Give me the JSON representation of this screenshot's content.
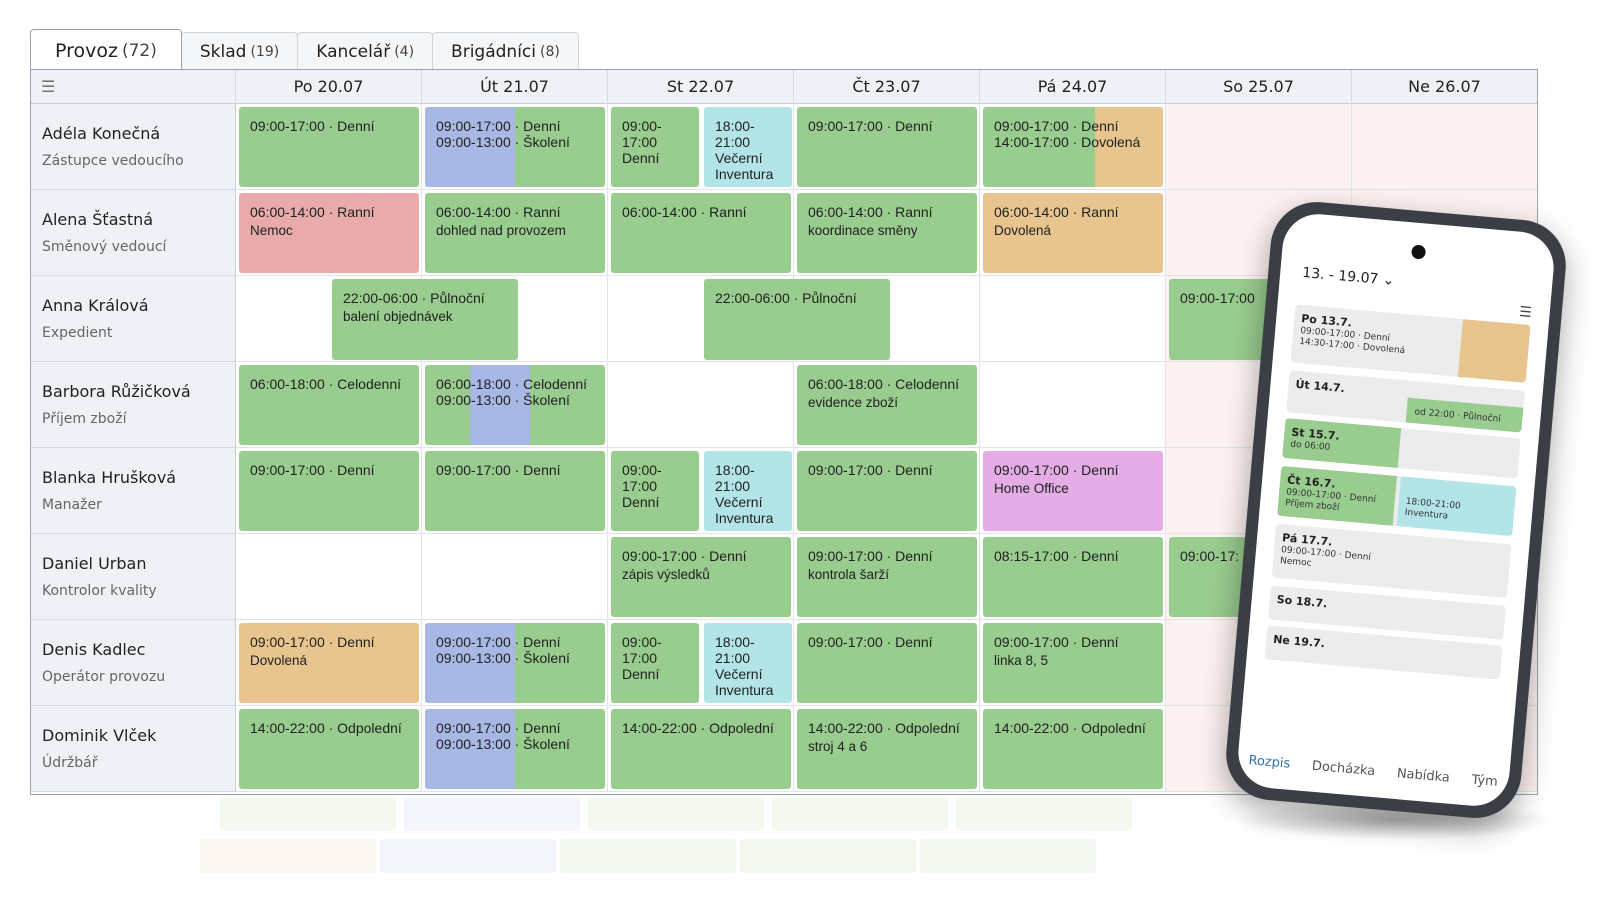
{
  "tabs": [
    {
      "label": "Provoz",
      "count": "(72)",
      "active": true
    },
    {
      "label": "Sklad",
      "count": "(19)",
      "active": false
    },
    {
      "label": "Kancelář",
      "count": "(4)",
      "active": false
    },
    {
      "label": "Brigádníci",
      "count": "(8)",
      "active": false
    }
  ],
  "days": [
    "Po 20.07",
    "Út 21.07",
    "St 22.07",
    "Čt 23.07",
    "Pá 24.07",
    "So 25.07",
    "Ne 26.07"
  ],
  "employees": [
    {
      "name": "Adéla Konečná",
      "role": "Zástupce vedoucího"
    },
    {
      "name": "Alena Šťastná",
      "role": "Směnový vedoucí"
    },
    {
      "name": "Anna Králová",
      "role": "Expedient"
    },
    {
      "name": "Barbora Růžičková",
      "role": "Příjem zboží"
    },
    {
      "name": "Blanka Hrušková",
      "role": "Manažer"
    },
    {
      "name": "Daniel Urban",
      "role": "Kontrolor kvality"
    },
    {
      "name": "Denis Kadlec",
      "role": "Operátor provozu"
    },
    {
      "name": "Dominik Vlček",
      "role": "Údržbář"
    }
  ],
  "shifts": {
    "s0_0": [
      "09:00-17:00 · Denní"
    ],
    "s0_1": [
      "09:00-17:00 · Denní",
      "09:00-13:00 · Školení"
    ],
    "s0_2a": [
      "09:00-",
      "17:00",
      "Denní"
    ],
    "s0_2b": [
      "18:00-",
      "21:00",
      "Večerní",
      "Inventura"
    ],
    "s0_3": [
      "09:00-17:00 · Denní"
    ],
    "s0_4": [
      "09:00-17:00 · Denní",
      "14:00-17:00 · Dovolená"
    ],
    "s1_0": [
      "06:00-14:00 · Ranní",
      "Nemoc"
    ],
    "s1_1": [
      "06:00-14:00 · Ranní",
      "dohled nad provozem"
    ],
    "s1_2": [
      "06:00-14:00 · Ranní"
    ],
    "s1_3": [
      "06:00-14:00 · Ranní",
      "koordinace směny"
    ],
    "s1_4": [
      "06:00-14:00 · Ranní",
      "Dovolená"
    ],
    "s2_a": [
      "22:00-06:00 · Půlnoční",
      "balení objednávek"
    ],
    "s2_b": [
      "22:00-06:00 · Půlnoční"
    ],
    "s2_c": [
      "09:00-17:00"
    ],
    "s3_0": [
      "06:00-18:00 · Celodenní"
    ],
    "s3_1": [
      "06:00-18:00 · Celodenní",
      "09:00-13:00 · Školení"
    ],
    "s3_3": [
      "06:00-18:00 · Celodenní",
      "evidence zboží"
    ],
    "s4_0": [
      "09:00-17:00 · Denní"
    ],
    "s4_1": [
      "09:00-17:00 · Denní"
    ],
    "s4_2a": [
      "09:00-",
      "17:00",
      "Denní"
    ],
    "s4_2b": [
      "18:00-",
      "21:00",
      "Večerní",
      "Inventura"
    ],
    "s4_3": [
      "09:00-17:00 · Denní"
    ],
    "s4_4": [
      "09:00-17:00 · Denní",
      "Home Office"
    ],
    "s5_2": [
      "09:00-17:00 · Denní",
      "zápis výsledků"
    ],
    "s5_3": [
      "09:00-17:00 · Denní",
      "kontrola šarží"
    ],
    "s5_4": [
      "08:15-17:00 · Denní"
    ],
    "s5_5": [
      "09:00-17:"
    ],
    "s6_0": [
      "09:00-17:00 · Denní",
      "Dovolená"
    ],
    "s6_1": [
      "09:00-17:00 · Denní",
      "09:00-13:00 · Školení"
    ],
    "s6_2a": [
      "09:00-",
      "17:00",
      "Denní"
    ],
    "s6_2b": [
      "18:00-",
      "21:00",
      "Večerní",
      "Inventura"
    ],
    "s6_3": [
      "09:00-17:00 · Denní"
    ],
    "s6_4": [
      "09:00-17:00 · Denní",
      "linka 8, 5"
    ],
    "s7_0": [
      "14:00-22:00 · Odpolední"
    ],
    "s7_1": [
      "09:00-17:00 · Denní",
      "09:00-13:00 · Školení"
    ],
    "s7_2": [
      "14:00-22:00 · Odpolední"
    ],
    "s7_3": [
      "14:00-22:00 · Odpolední",
      "stroj 4 a 6"
    ],
    "s7_4": [
      "14:00-22:00 · Odpolední"
    ]
  },
  "colors": {
    "green": "#99cc8f",
    "red": "#e8aaaa",
    "orange": "#e8c58e",
    "blue": "#a8b8e5",
    "cyan": "#b3e5e8",
    "pink": "#e5ade6",
    "accent": "#2f6fb0"
  },
  "phone": {
    "week": "13. - 19.07 ⌄",
    "days": [
      {
        "label": "Po 13.7.",
        "lines": [
          "09:00-17:00 · Denní",
          "14:30-17:00 · Dovolená"
        ]
      },
      {
        "label": "Út 14.7.",
        "lines": [
          "od 22:00 · Půlnoční"
        ]
      },
      {
        "label": "St 15.7.",
        "lines": [
          "do 06:00"
        ]
      },
      {
        "label": "Čt 16.7.",
        "lines": [
          "09:00-17:00 · Denní",
          "Příjem zboží",
          "18:00-21:00",
          "Inventura"
        ]
      },
      {
        "label": "Pá 17.7.",
        "lines": [
          "09:00-17:00 · Denní",
          "Nemoc"
        ]
      },
      {
        "label": "So 18.7.",
        "lines": []
      },
      {
        "label": "Ne 19.7.",
        "lines": []
      }
    ],
    "nav": [
      "Rozpis",
      "Docházka",
      "Nabídka",
      "Tým"
    ]
  }
}
